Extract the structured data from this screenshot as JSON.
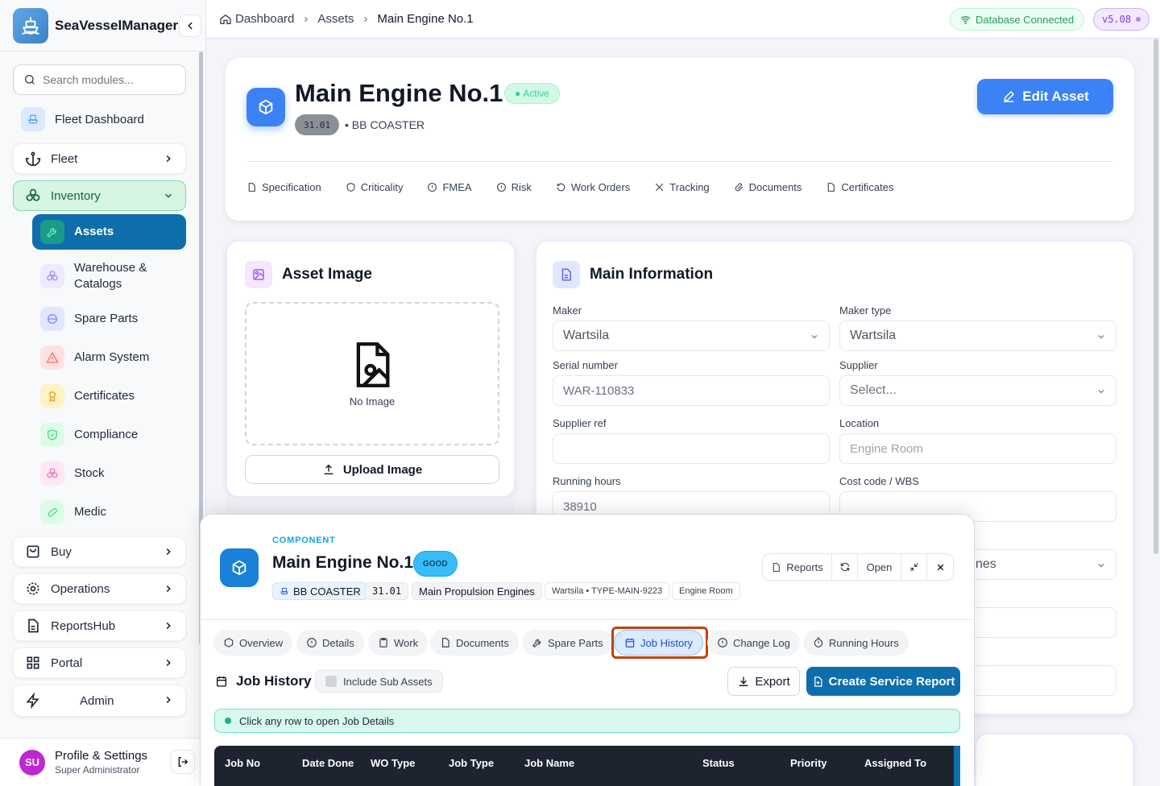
{
  "app": {
    "name": "SeaVesselManager",
    "search_placeholder": "Search modules..."
  },
  "sidebar": {
    "fleet_dashboard": "Fleet Dashboard",
    "fleet": "Fleet",
    "inventory": "Inventory",
    "sub": {
      "assets": "Assets",
      "warehouse_line1": "Warehouse &",
      "warehouse_line2": "Catalogs",
      "spare_parts": "Spare Parts",
      "alarm_system": "Alarm System",
      "certificates": "Certificates",
      "compliance": "Compliance",
      "stock": "Stock",
      "medic": "Medic"
    },
    "buy": "Buy",
    "operations": "Operations",
    "reportshub": "ReportsHub",
    "portal": "Portal",
    "admin": "Admin"
  },
  "profile": {
    "initials": "SU",
    "name": "Profile & Settings",
    "role": "Super Administrator"
  },
  "breadcrumb": {
    "home": "Dashboard",
    "section": "Assets",
    "current": "Main Engine No.1"
  },
  "status": {
    "db": "Database Connected",
    "version": "v5.08"
  },
  "asset": {
    "title": "Main Engine No.1",
    "status": "Active",
    "code": "31.01",
    "vessel": "BB COASTER",
    "edit_label": "Edit Asset",
    "tabs": [
      "Specification",
      "Criticality",
      "FMEA",
      "Risk",
      "Work Orders",
      "Tracking",
      "Documents",
      "Certificates"
    ]
  },
  "image_card": {
    "title": "Asset Image",
    "empty": "No Image",
    "upload": "Upload Image"
  },
  "info_card": {
    "title": "Main Information",
    "maker_label": "Maker",
    "maker_value": "Wartsila",
    "maker_type_label": "Maker type",
    "maker_type_value": "Wartsila",
    "serial_label": "Serial number",
    "serial_value": "WAR-110833",
    "supplier_label": "Supplier",
    "supplier_value": "Select...",
    "supplier_ref_label": "Supplier ref",
    "supplier_ref_value": "",
    "location_label": "Location",
    "location_placeholder": "Engine Room",
    "running_label": "Running hours",
    "running_value": "38910",
    "cost_label": "Cost code / WBS",
    "cost_value": "",
    "partial_value": "nes"
  },
  "panel": {
    "eyebrow": "COMPONENT",
    "title": "Main Engine No.1",
    "condition": "GOOD",
    "chips": {
      "vessel": "BB COASTER",
      "code": "31.01",
      "group": "Main Propulsion Engines",
      "maker": "Wartsila • TYPE-MAIN-9223",
      "location": "Engine Room"
    },
    "actions": {
      "reports": "Reports",
      "open": "Open"
    },
    "tabs": [
      "Overview",
      "Details",
      "Work",
      "Documents",
      "Spare Parts",
      "Job History",
      "Change Log",
      "Running Hours"
    ],
    "job_history": {
      "title": "Job History",
      "include_sub": "Include Sub Assets",
      "export": "Export",
      "create": "Create Service Report",
      "info": "Click any row to open Job Details",
      "columns": [
        "Job No",
        "Date Done",
        "WO Type",
        "Job Type",
        "Job Name",
        "Status",
        "Priority",
        "Assigned To"
      ]
    }
  }
}
